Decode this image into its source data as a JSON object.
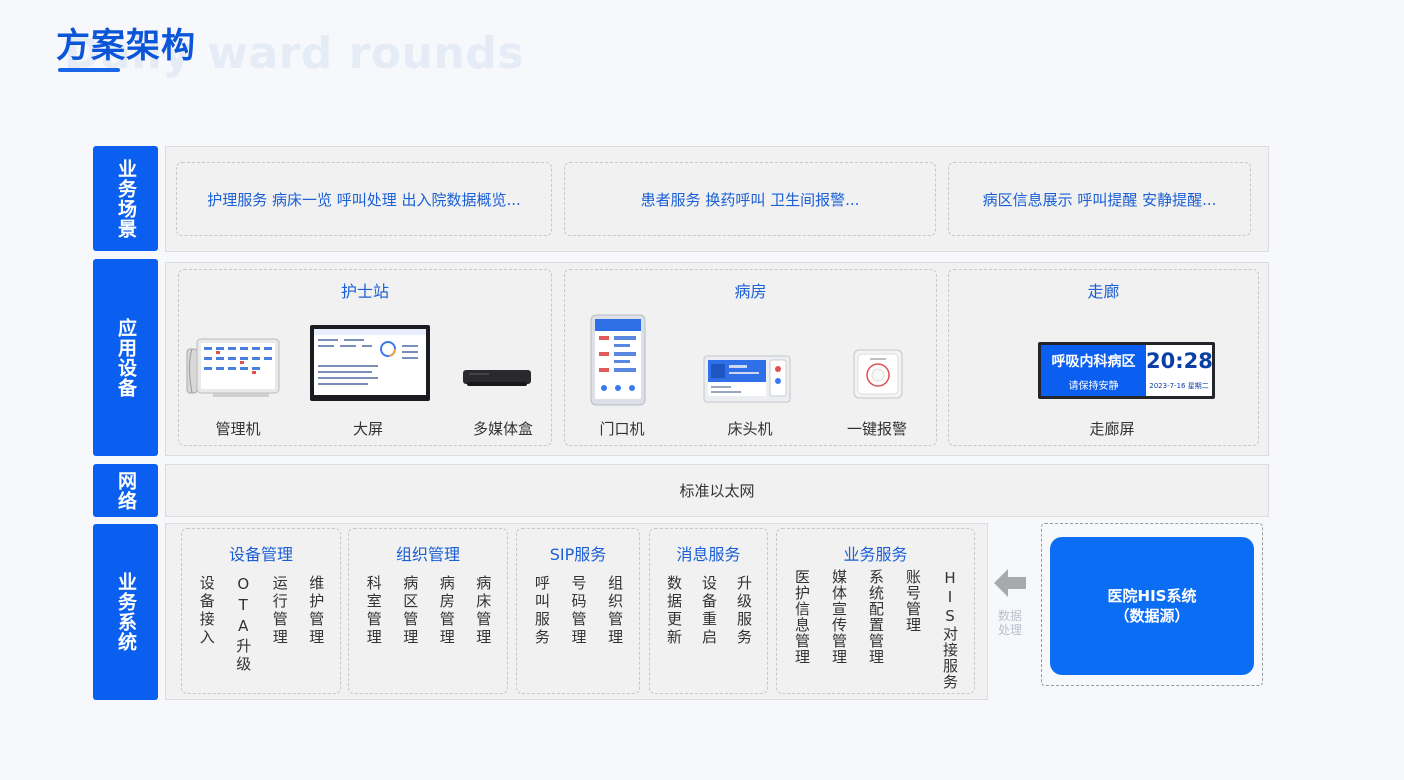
{
  "header": {
    "title": "方案架构",
    "watermark": "Daily ward rounds"
  },
  "layers": {
    "scene": {
      "label": "业务场景"
    },
    "device": {
      "label": "应用设备"
    },
    "network": {
      "label": "网络"
    },
    "system": {
      "label": "业务系统"
    }
  },
  "scenes": [
    {
      "text": "护理服务  病床一览 呼叫处理 出入院数据概览..."
    },
    {
      "text": "患者服务  换药呼叫  卫生间报警..."
    },
    {
      "text": "病区信息展示 呼叫提醒 安静提醒..."
    }
  ],
  "device_groups": {
    "nurse_station": {
      "title": "护士站",
      "devices": [
        "管理机",
        "大屏",
        "多媒体盒"
      ]
    },
    "ward": {
      "title": "病房",
      "devices": [
        "门口机",
        "床头机",
        "一键报警"
      ]
    },
    "corridor": {
      "title": "走廊",
      "devices": [
        "走廊屏"
      ],
      "screen": {
        "ward_name": "呼吸内科病区",
        "notice": "请保持安静",
        "time": "20:28",
        "date": "2023-7-16 星期二"
      }
    }
  },
  "network": {
    "text": "标准以太网"
  },
  "services": [
    {
      "title": "设备管理",
      "items": [
        "设备接入",
        "OTA升级",
        "运行管理",
        "维护管理"
      ]
    },
    {
      "title": "组织管理",
      "items": [
        "科室管理",
        "病区管理",
        "病房管理",
        "病床管理"
      ]
    },
    {
      "title": "SIP服务",
      "items": [
        "呼叫服务",
        "号码管理",
        "组织管理"
      ]
    },
    {
      "title": "消息服务",
      "items": [
        "数据更新",
        "设备重启",
        "升级服务"
      ]
    },
    {
      "title": "业务服务",
      "items": [
        "医护信息管理",
        "媒体宣传管理",
        "系统配置管理",
        "账号管理",
        "HIS对接服务"
      ]
    }
  ],
  "his": {
    "line1": "医院HIS系统",
    "line2": "（数据源）",
    "arrow_label": "数据处理"
  },
  "colors": {
    "primary": "#0b5ff0",
    "accent_text": "#1a5fd6",
    "panel_bg": "#f1f1f1"
  }
}
